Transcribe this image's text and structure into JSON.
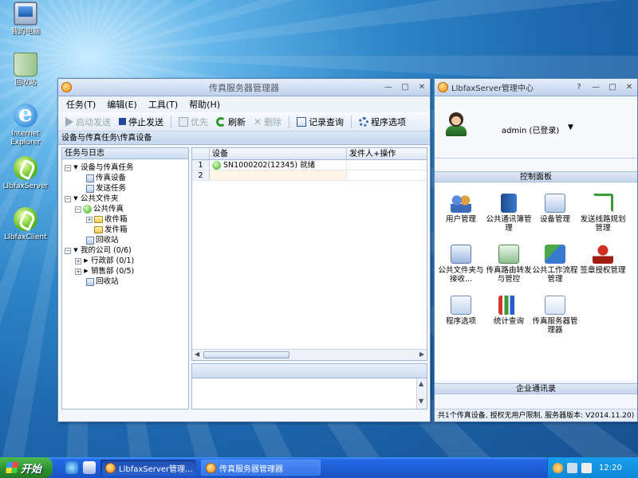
{
  "desktop": {
    "icons": [
      {
        "label": "我的电脑",
        "icon": "my-computer-icon"
      },
      {
        "label": "回收站",
        "icon": "recycle-bin-icon"
      },
      {
        "label": "Internet\nExplorer",
        "icon": "internet-explorer-icon"
      },
      {
        "label": "LlbfaxServer",
        "icon": "llbfax-server-icon"
      },
      {
        "label": "LlbfaxClient",
        "icon": "llbfax-client-icon"
      }
    ]
  },
  "manager": {
    "title": "传真服务器管理器",
    "menu": [
      "任务(T)",
      "编辑(E)",
      "工具(T)",
      "帮助(H)"
    ],
    "toolbar": [
      "启动发送",
      "停止发送",
      "优先",
      "刷新",
      "删除",
      "记录查询",
      "程序选项"
    ],
    "path": "设备与传真任务\\传真设备",
    "tree_title": "任务与日志",
    "tree": [
      "设备与传真任务",
      "传真设备",
      "发送任务",
      "公共文件夹",
      "公共传真",
      "收件箱",
      "发件箱",
      "回收站",
      "我的公司 (0/6)",
      "行政部 (0/1)",
      "销售部 (0/5)",
      "回收站"
    ],
    "grid": {
      "headers": [
        "设备",
        "发件人+操作"
      ],
      "rows": [
        {
          "num": "1",
          "device": "SN1000202(12345) 就绪"
        },
        {
          "num": "2",
          "device": ""
        }
      ]
    }
  },
  "center": {
    "title": "LlbfaxServer管理中心",
    "user": "admin (已登录)",
    "panel_title": "控制面板",
    "items": [
      {
        "label": "用户管理",
        "icon": "users-icon"
      },
      {
        "label": "公共通讯簿管理",
        "icon": "address-book-icon"
      },
      {
        "label": "设备管理",
        "icon": "device-settings-icon"
      },
      {
        "label": "发送线路规划管理",
        "icon": "route-planning-icon"
      },
      {
        "label": "公共文件夹与接收...",
        "icon": "public-folder-icon"
      },
      {
        "label": "传真路由转发与管控",
        "icon": "fax-routing-icon"
      },
      {
        "label": "公共工作流程管理",
        "icon": "workflow-icon"
      },
      {
        "label": "签章授权管理",
        "icon": "seal-icon"
      },
      {
        "label": "程序选项",
        "icon": "program-options-icon"
      },
      {
        "label": "统计查询",
        "icon": "statistics-icon"
      },
      {
        "label": "传真服务器管理器",
        "icon": "fax-server-manager-icon"
      }
    ],
    "address_title": "企业通讯录",
    "status": "共1个传真设备, 授权无用户限制, 服务器版本: V2014.11.20)"
  },
  "taskbar": {
    "start": "开始",
    "tasks": [
      "LlbfaxServer管理...",
      "传真服务器管理器"
    ],
    "clock": "12:20"
  }
}
